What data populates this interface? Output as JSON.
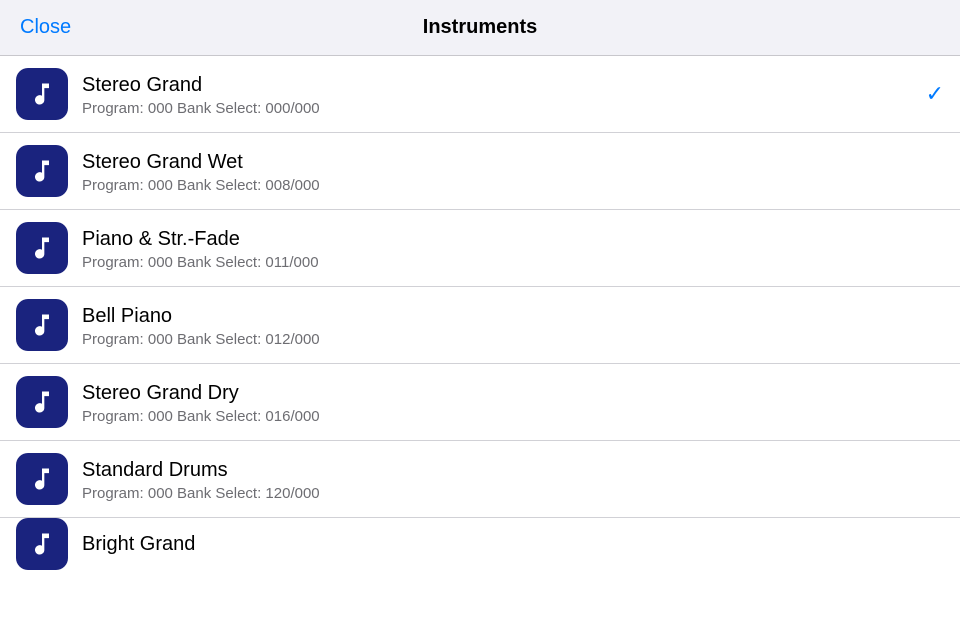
{
  "header": {
    "title": "Instruments",
    "close_label": "Close"
  },
  "instruments": [
    {
      "name": "Stereo Grand",
      "detail": "Program: 000 Bank Select: 000/000",
      "selected": true
    },
    {
      "name": "Stereo Grand Wet",
      "detail": "Program: 000 Bank Select: 008/000",
      "selected": false
    },
    {
      "name": "Piano & Str.-Fade",
      "detail": "Program: 000 Bank Select: 011/000",
      "selected": false
    },
    {
      "name": "Bell Piano",
      "detail": "Program: 000 Bank Select: 012/000",
      "selected": false
    },
    {
      "name": "Stereo Grand Dry",
      "detail": "Program: 000 Bank Select: 016/000",
      "selected": false
    },
    {
      "name": "Standard Drums",
      "detail": "Program: 000 Bank Select: 120/000",
      "selected": false
    },
    {
      "name": "Bright Grand",
      "detail": "",
      "selected": false,
      "partial": true
    }
  ],
  "icons": {
    "music_note": "music-note-icon",
    "checkmark": "✓"
  }
}
